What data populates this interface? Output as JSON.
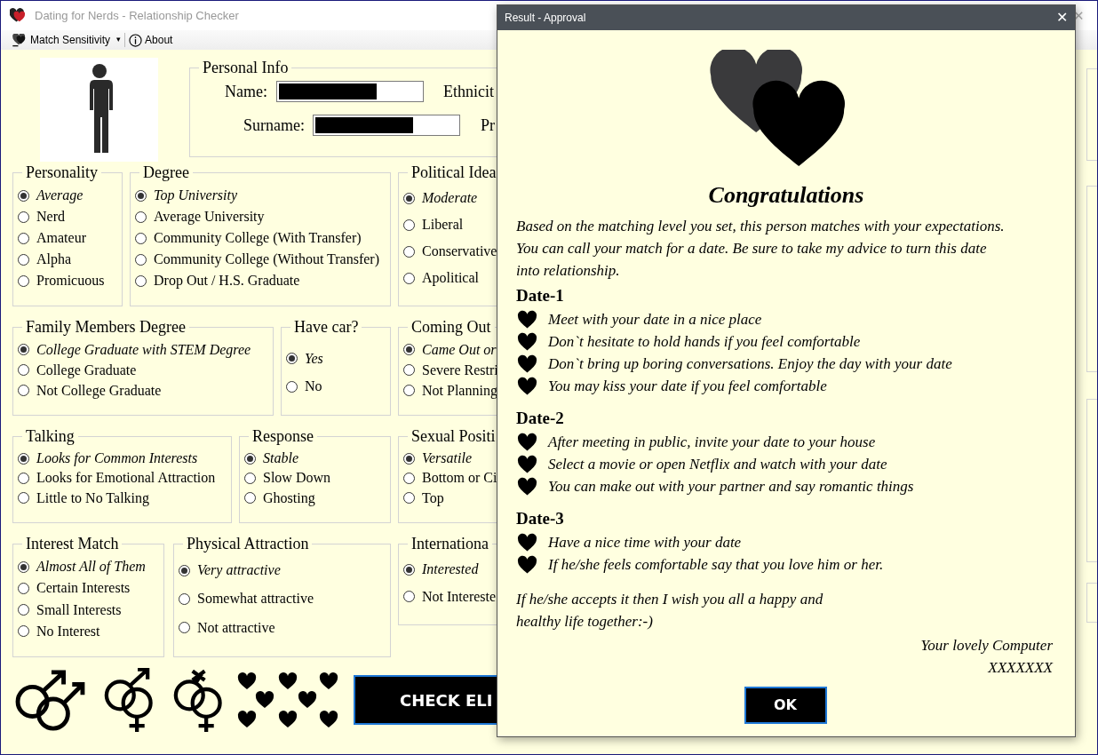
{
  "window": {
    "title": "Dating for Nerds - Relationship Checker",
    "close": "✕"
  },
  "toolbar": [
    {
      "kind": "dropdown",
      "label": "Match Sensitivity",
      "caret": "▾"
    },
    {
      "kind": "button",
      "label": "About"
    }
  ],
  "personal_info": {
    "title": "Personal Info",
    "fields": [
      {
        "label": "Name:",
        "side_label": "Ethnicit"
      },
      {
        "label": "Surname:",
        "side_label": "Pr"
      }
    ]
  },
  "group_rows": [
    [
      {
        "title": "Personality",
        "options": [
          {
            "label": "Average",
            "selected": true
          },
          {
            "label": "Nerd",
            "selected": false
          },
          {
            "label": "Amateur",
            "selected": false
          },
          {
            "label": "Alpha",
            "selected": false
          },
          {
            "label": "Promicuous",
            "selected": false
          }
        ]
      },
      {
        "title": "Degree",
        "options": [
          {
            "label": "Top University",
            "selected": true
          },
          {
            "label": "Average University",
            "selected": false
          },
          {
            "label": "Community College (With Transfer)",
            "selected": false
          },
          {
            "label": "Community College (Without Transfer)",
            "selected": false
          },
          {
            "label": "Drop Out / H.S. Graduate",
            "selected": false
          }
        ]
      },
      {
        "title": "Political Idea",
        "options": [
          {
            "label": "Moderate",
            "selected": true
          },
          {
            "label": "Liberal",
            "selected": false
          },
          {
            "label": "Conservative",
            "selected": false
          },
          {
            "label": "Apolitical",
            "selected": false
          }
        ]
      }
    ],
    [
      {
        "title": "Family Members Degree",
        "options": [
          {
            "label": "College Graduate with STEM Degree",
            "selected": true
          },
          {
            "label": "College Graduate",
            "selected": false
          },
          {
            "label": "Not College Graduate",
            "selected": false
          }
        ]
      },
      {
        "title": "Have car?",
        "options": [
          {
            "label": "Yes",
            "selected": true
          },
          {
            "label": "No",
            "selected": false
          }
        ]
      },
      {
        "title": "Coming Out",
        "options": [
          {
            "label": "Came Out or",
            "selected": true
          },
          {
            "label": "Severe Restri",
            "selected": false
          },
          {
            "label": "Not Planning",
            "selected": false
          }
        ]
      }
    ],
    [
      {
        "title": "Talking",
        "options": [
          {
            "label": "Looks for Common Interests",
            "selected": true
          },
          {
            "label": "Looks for Emotional Attraction",
            "selected": false
          },
          {
            "label": "Little to No Talking",
            "selected": false
          }
        ]
      },
      {
        "title": "Response",
        "options": [
          {
            "label": "Stable",
            "selected": true
          },
          {
            "label": "Slow Down",
            "selected": false
          },
          {
            "label": "Ghosting",
            "selected": false
          }
        ]
      },
      {
        "title": "Sexual Positi",
        "options": [
          {
            "label": "Versatile",
            "selected": true
          },
          {
            "label": "Bottom or Ci",
            "selected": false
          },
          {
            "label": "Top",
            "selected": false
          }
        ]
      }
    ],
    [
      {
        "title": "Interest Match",
        "options": [
          {
            "label": "Almost All of Them",
            "selected": true
          },
          {
            "label": "Certain Interests",
            "selected": false
          },
          {
            "label": "Small Interests",
            "selected": false
          },
          {
            "label": "No Interest",
            "selected": false
          }
        ]
      },
      {
        "title": "Physical Attraction",
        "options": [
          {
            "label": "Very attractive",
            "selected": true
          },
          {
            "label": "Somewhat attractive",
            "selected": false
          },
          {
            "label": "Not attractive",
            "selected": false
          }
        ]
      },
      {
        "title": "Internationa",
        "options": [
          {
            "label": "Interested",
            "selected": true
          },
          {
            "label": "Not Intereste",
            "selected": false
          }
        ]
      }
    ]
  ],
  "check_button": "CHECK ELI",
  "dialog": {
    "title": "Result - Approval",
    "close": "✕",
    "heading": "Congratulations",
    "intro": "Based on the matching level you set, this person matches with your expectations. You can call your match for a date. Be sure to take my advice to turn this date into relationship.",
    "dates": [
      {
        "title": "Date-1",
        "tips": [
          "Meet with your date in a nice place",
          "Don`t hesitate to hold hands if you feel comfortable",
          "Don`t bring up boring conversations. Enjoy the day with your date",
          "You may kiss your date if you feel comfortable"
        ]
      },
      {
        "title": "Date-2",
        "tips": [
          "After meeting in public, invite your date to your house",
          "Select a movie or open Netflix and watch with your date",
          "You can make out with your partner and say romantic things"
        ]
      },
      {
        "title": "Date-3",
        "tips": [
          "Have a nice time with your date",
          "If he/she feels comfortable say that you love him or her."
        ]
      }
    ],
    "closing": [
      "If he/she accepts it then I wish you all a happy and",
      "healthy life together:-)"
    ],
    "signature": [
      "Your lovely Computer",
      "XXXXXXX"
    ],
    "ok": "OK"
  }
}
